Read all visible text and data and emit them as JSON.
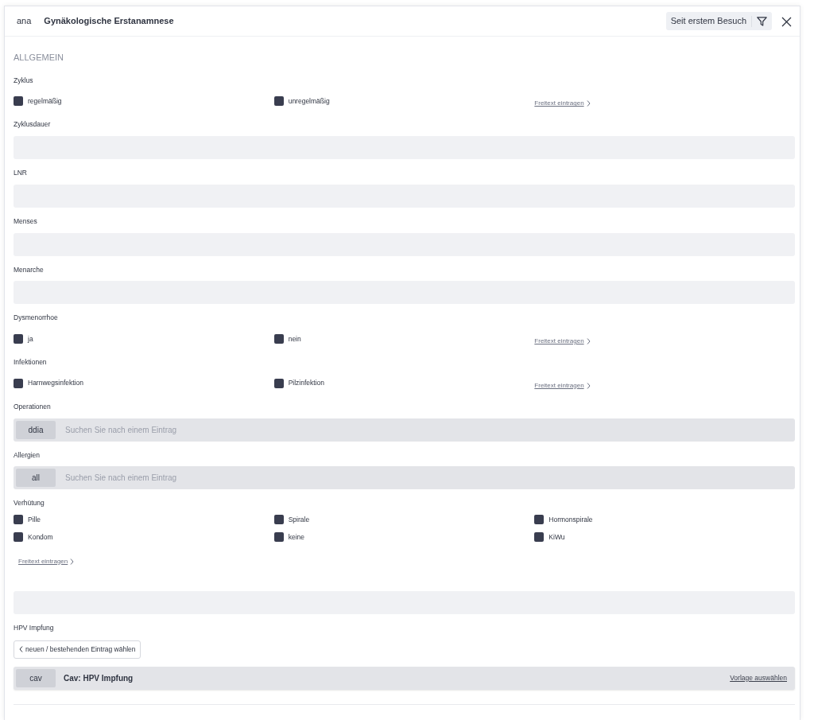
{
  "header": {
    "code": "ana",
    "title": "Gynäkologische Erstanamnese",
    "filter_label": "Seit erstem Besuch"
  },
  "section_title": "ALLGEMEIN",
  "fields": [
    {
      "kind": "checkboxes",
      "label": "Zyklus",
      "options": [
        {
          "label": "regelmäßig",
          "checked": false
        },
        {
          "label": "unregelmäßig",
          "checked": false
        }
      ],
      "link": "Freitext eintragen"
    },
    {
      "kind": "text",
      "label": "Zyklusdauer"
    },
    {
      "kind": "text",
      "label": "LNR"
    },
    {
      "kind": "text",
      "label": "Menses"
    },
    {
      "kind": "text",
      "label": "Menarche"
    },
    {
      "kind": "checkboxes",
      "label": "Dysmenorrhoe",
      "options": [
        {
          "label": "ja",
          "checked": false
        },
        {
          "label": "nein",
          "checked": false
        }
      ],
      "link": "Freitext eintragen"
    },
    {
      "kind": "checkboxes",
      "label": "Infektionen",
      "options": [
        {
          "label": "Harnwegsinfektion",
          "checked": false
        },
        {
          "label": "Pilzinfektion",
          "checked": false
        }
      ],
      "link": "Freitext eintragen"
    },
    {
      "kind": "search",
      "label": "Operationen",
      "tag": "ddia",
      "placeholder": "Suchen Sie nach einem Eintrag"
    },
    {
      "kind": "search",
      "label": "Allergien",
      "tag": "all",
      "placeholder": "Suchen Sie nach einem Eintrag"
    },
    {
      "kind": "checkboxes",
      "label": "Verhütung",
      "options": [
        {
          "label": "Pille",
          "checked": false
        },
        {
          "label": "Spirale",
          "checked": false
        },
        {
          "label": "Hormonspirale",
          "checked": false
        },
        {
          "label": "Kondom",
          "checked": false
        },
        {
          "label": "keine",
          "checked": false
        },
        {
          "label": "KiWu",
          "checked": false
        }
      ],
      "link": "Freitext eintragen"
    },
    {
      "kind": "text"
    },
    {
      "kind": "entry",
      "label": "HPV Impfung",
      "button": "neuen / bestehenden Eintrag wählen",
      "tag": "cav",
      "title": "Cav: HPV Impfung",
      "link": "Vorlage auswählen"
    }
  ]
}
